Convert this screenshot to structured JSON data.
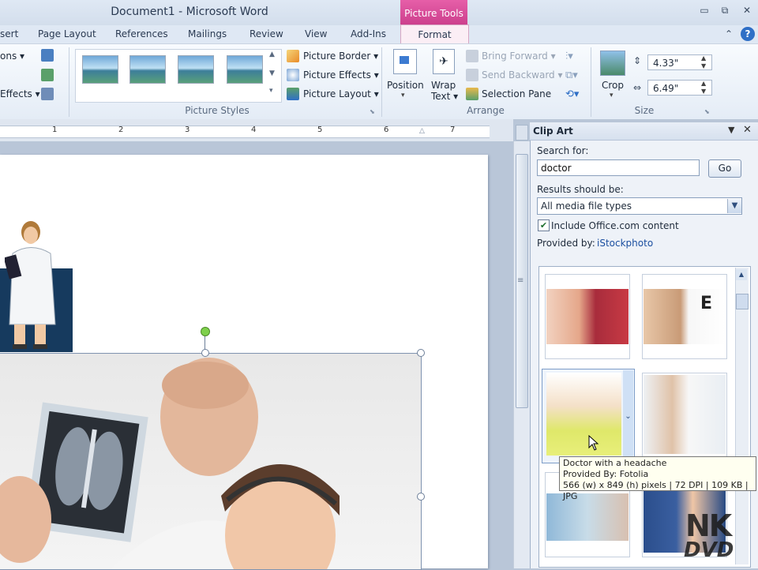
{
  "window": {
    "title": "Document1  -  Microsoft Word",
    "contextual_group": "Picture Tools",
    "controls": [
      "▭",
      "⧉",
      "✕"
    ]
  },
  "tabs": [
    "sert",
    "Page Layout",
    "References",
    "Mailings",
    "Review",
    "View",
    "Add-Ins",
    "Format"
  ],
  "ribbon": {
    "adjust": {
      "item1": "ons",
      "item2": "Effects"
    },
    "picture_styles": {
      "label": "Picture Styles",
      "border": "Picture Border",
      "effects": "Picture Effects",
      "layout": "Picture Layout"
    },
    "arrange": {
      "label": "Arrange",
      "position": "Position",
      "wrap_text_1": "Wrap",
      "wrap_text_2": "Text",
      "bring_forward": "Bring Forward",
      "send_backward": "Send Backward",
      "selection_pane": "Selection Pane"
    },
    "size": {
      "label": "Size",
      "crop": "Crop",
      "height": "4.33\"",
      "width": "6.49\""
    }
  },
  "ruler": {
    "numbers": [
      "1",
      "2",
      "3",
      "4",
      "5",
      "6",
      "7"
    ]
  },
  "clip_art": {
    "title": "Clip Art",
    "search_label": "Search for:",
    "search_value": "doctor",
    "go": "Go",
    "results_label": "Results should be:",
    "media_type": "All media file types",
    "include_office": "Include Office.com content",
    "include_office_checked": true,
    "provided_label": "Provided by:",
    "provider": "iStockphoto",
    "tooltip": {
      "line1": "Doctor with a headache",
      "line2": "Provided By: Fotolia",
      "line3": "566 (w) x 849 (h) pixels | 72 DPI | 109 KB | JPG"
    }
  },
  "watermark": {
    "line1": "NK",
    "line2": "DVD"
  }
}
